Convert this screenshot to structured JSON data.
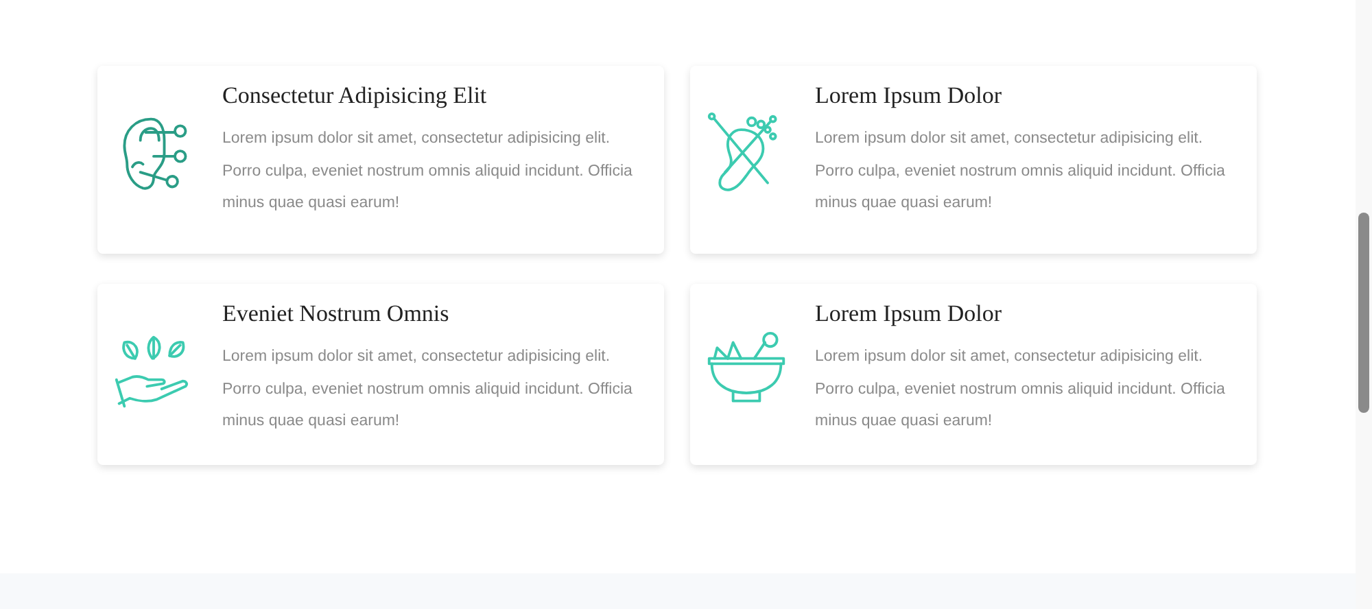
{
  "features": [
    {
      "title": "Consectetur Adipisicing Elit",
      "text": "Lorem ipsum dolor sit amet, consectetur adipisicing elit. Porro culpa, eveniet nostrum omnis aliquid incidunt. Officia minus quae quasi earum!"
    },
    {
      "title": "Lorem Ipsum Dolor",
      "text": "Lorem ipsum dolor sit amet, consectetur adipisicing elit. Porro culpa, eveniet nostrum omnis aliquid incidunt. Officia minus quae quasi earum!"
    },
    {
      "title": "Eveniet Nostrum Omnis",
      "text": "Lorem ipsum dolor sit amet, consectetur adipisicing elit. Porro culpa, eveniet nostrum omnis aliquid incidunt. Officia minus quae quasi earum!"
    },
    {
      "title": "Lorem Ipsum Dolor",
      "text": "Lorem ipsum dolor sit amet, consectetur adipisicing elit. Porro culpa, eveniet nostrum omnis aliquid incidunt. Officia minus quae quasi earum!"
    }
  ]
}
